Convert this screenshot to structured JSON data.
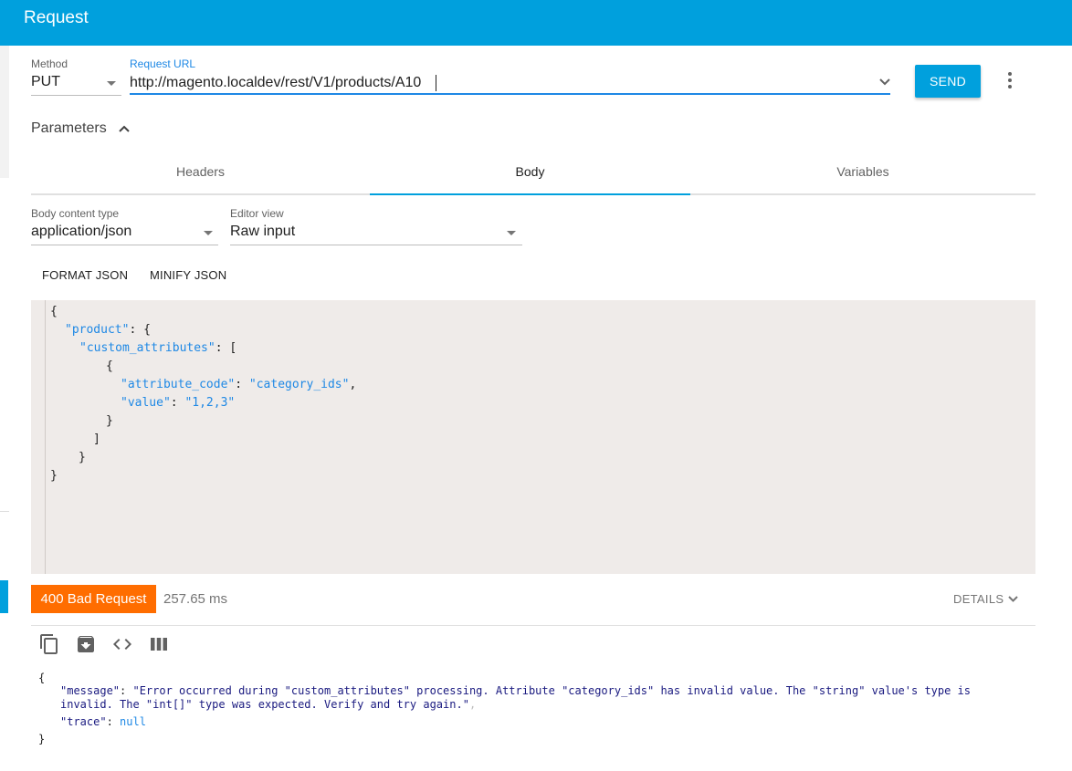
{
  "appbar": {
    "title": "Request"
  },
  "request": {
    "method_label": "Method",
    "method_value": "PUT",
    "url_label": "Request URL",
    "url_value": "http://magento.localdev/rest/V1/products/A10",
    "send_label": "SEND"
  },
  "parameters": {
    "title": "Parameters",
    "tabs": [
      {
        "label": "Headers"
      },
      {
        "label": "Body"
      },
      {
        "label": "Variables"
      }
    ],
    "active_tab": "Body"
  },
  "body": {
    "content_type_label": "Body content type",
    "content_type_value": "application/json",
    "editor_view_label": "Editor view",
    "editor_view_value": "Raw input",
    "format_button": "FORMAT JSON",
    "minify_button": "MINIFY JSON",
    "json_lines": {
      "l1": "{",
      "l2_key": "\"product\"",
      "l2_rest": ": {",
      "l3_key": "\"custom_attributes\"",
      "l3_rest": ": [",
      "l4": "{",
      "l5_key": "\"attribute_code\"",
      "l5_sep": ": ",
      "l5_val": "\"category_ids\"",
      "l5_end": ",",
      "l6_key": "\"value\"",
      "l6_sep": ": ",
      "l6_val": "\"1,2,3\"",
      "l7": "}",
      "l8": "]",
      "l9": "}",
      "l10": "}"
    }
  },
  "response": {
    "status": "400 Bad Request",
    "time": "257.65 ms",
    "details_label": "DETAILS",
    "json": {
      "open": "{",
      "message_key": "\"message\"",
      "message_val_1": "\"Error occurred during \"custom_attributes\" processing. Attribute \"category_ids\" has invalid value. The \"string\" value's type is",
      "message_val_2": "invalid. The \"int[]\" type was expected. Verify and try again.\"",
      "comma": ",",
      "trace_key": "\"trace\"",
      "trace_val": "null",
      "close": "}"
    }
  },
  "colors": {
    "appbar": "#00a0dd",
    "accent": "#1e88e5",
    "error_badge": "#ff6d00",
    "editor_bg": "#efebe9"
  },
  "icons": {
    "method_dropdown": "triangle-down-icon",
    "url_dropdown": "chevron-down-icon",
    "more": "more-vert-icon",
    "parameters_toggle": "chevron-up-icon",
    "copy": "copy-icon",
    "save": "save-icon",
    "code": "code-icon",
    "columns": "columns-icon"
  }
}
